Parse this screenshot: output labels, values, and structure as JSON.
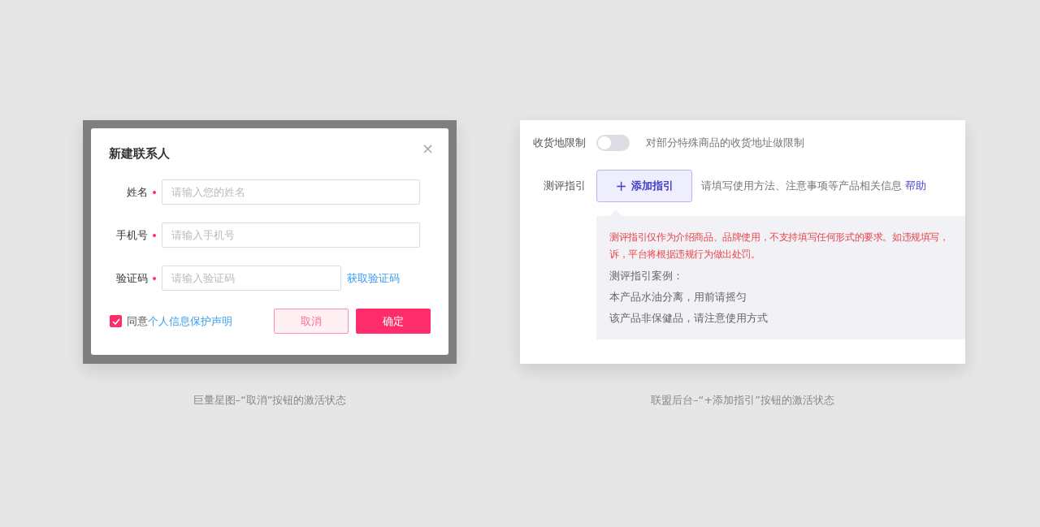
{
  "examples": [
    {
      "kind": "modal",
      "caption": "巨量星图–“取消”按钮的激活状态",
      "dialog": {
        "title": "新建联系人",
        "close": "×",
        "fields": [
          {
            "label": "姓名",
            "required": true,
            "placeholder": "请输入您的姓名"
          },
          {
            "label": "手机号",
            "required": true,
            "placeholder": "请输入手机号"
          },
          {
            "label": "验证码",
            "required": true,
            "placeholder": "请输入验证码",
            "action": "获取验证码"
          }
        ],
        "agree": {
          "checked": true,
          "text": "同意",
          "link": "个人信息保护声明"
        },
        "buttons": [
          {
            "label": "取消",
            "kind": "secondary",
            "active": true
          },
          {
            "label": "确定",
            "kind": "primary",
            "active": false
          }
        ]
      }
    },
    {
      "kind": "form",
      "caption": "联盟后台–“+添加指引”按钮的激活状态",
      "form": {
        "toggle_row": {
          "label": "收货地限制",
          "on": false,
          "description": "对部分特殊商品的收货地址做限制"
        },
        "guide_row": {
          "label": "测评指引",
          "button": {
            "icon": "+",
            "label": "添加指引",
            "active": true
          },
          "description": "请填写使用方法、注意事项等产品相关信息",
          "help": "帮助"
        },
        "tip": {
          "warning": [
            "测评指引仅作为介绍商品、品牌使用，不支持填写任何形式的要求。如违规填写，",
            "诉，平台将根据违规行为做出处罚。"
          ],
          "examples_title": "测评指引案例：",
          "examples": [
            "本产品水油分离，用前请摇匀",
            "该产品非保健品，请注意使用方式"
          ]
        }
      }
    }
  ]
}
